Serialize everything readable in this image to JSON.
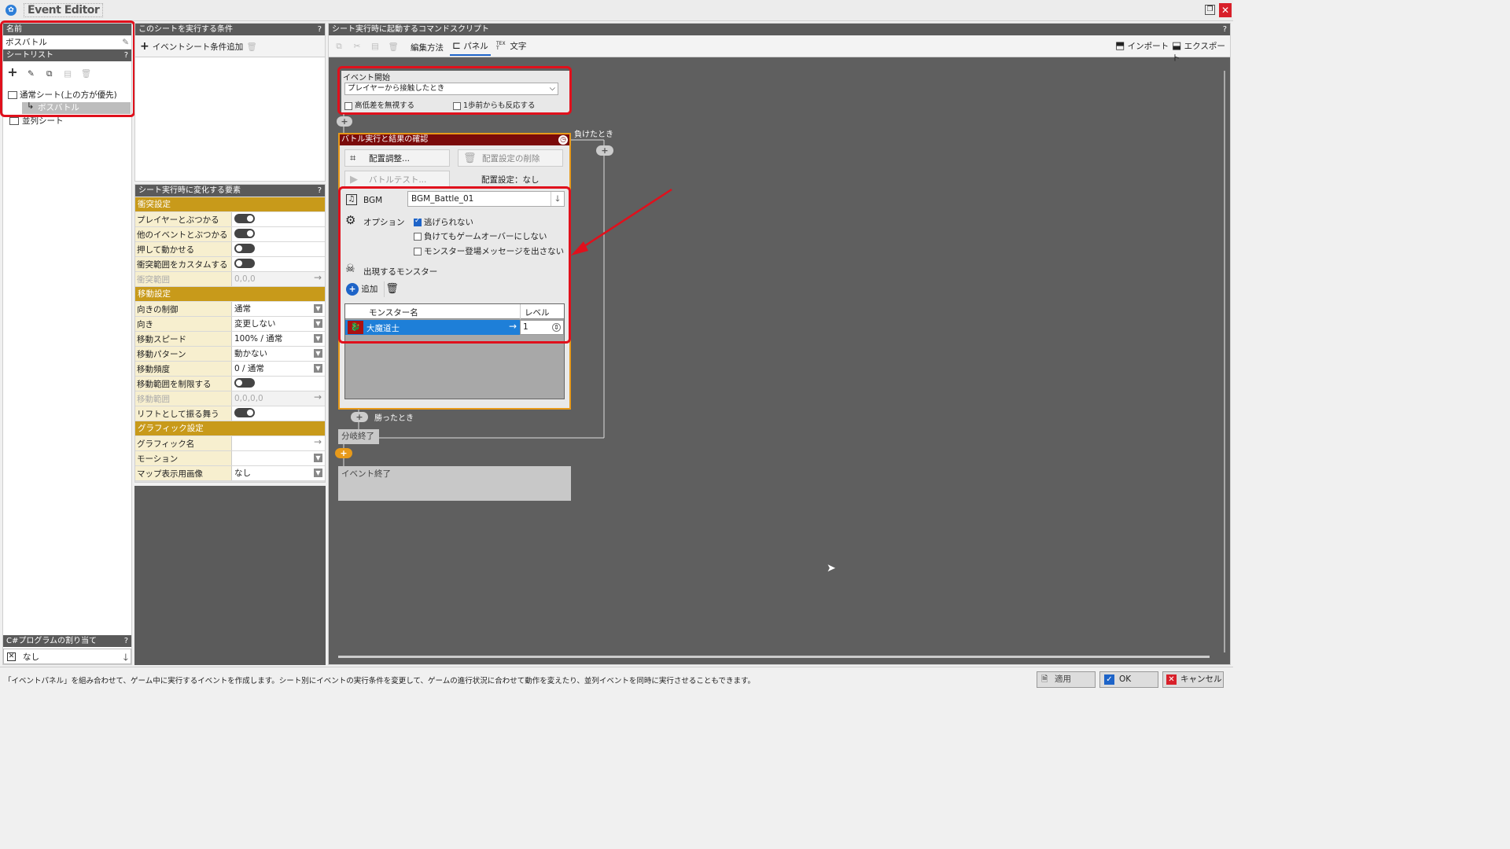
{
  "window": {
    "title": "Event Editor"
  },
  "left": {
    "name_header": "名前",
    "name_value": "ボスバトル",
    "sheetlist_header": "シートリスト",
    "tree": {
      "normal": "通常シート(上の方が優先)",
      "boss": "ボスバトル",
      "parallel": "並列シート"
    },
    "csharp_header": "C#プログラムの割り当て",
    "csharp_value": "なし"
  },
  "conditions": {
    "header": "このシートを実行する条件",
    "add_label": "イベントシート条件追加"
  },
  "props": {
    "header": "シート実行時に変化する要素",
    "sections": {
      "collision": "衝突設定",
      "movement": "移動設定",
      "graphic": "グラフィック設定"
    },
    "rows": {
      "player_hit": "プレイヤーとぶつかる",
      "event_hit": "他のイベントとぶつかる",
      "pushable": "押して動かせる",
      "custom_range": "衝突範囲をカスタムする",
      "range": "衝突範囲",
      "range_value": "0,0,0",
      "dir_control": "向きの制御",
      "dir_control_value": "通常",
      "dir": "向き",
      "dir_value": "変更しない",
      "speed": "移動スピード",
      "speed_value": "100% / 通常",
      "pattern": "移動パターン",
      "pattern_value": "動かない",
      "freq": "移動頻度",
      "freq_value": "0 / 通常",
      "limit": "移動範囲を制限する",
      "move_range": "移動範囲",
      "move_range_value": "0,0,0,0",
      "lift": "リフトとして振る舞う",
      "gfx_name": "グラフィック名",
      "motion": "モーション",
      "map_image": "マップ表示用画像",
      "map_image_value": "なし"
    }
  },
  "script": {
    "header": "シート実行時に起動するコマンドスクリプト",
    "toolbar": {
      "edit_mode": "編集方法",
      "panel": "パネル",
      "text": "文字",
      "text_icon": "TEXT",
      "import": "インポート",
      "export": "エクスポート"
    },
    "event_start": {
      "title": "イベント開始",
      "trigger": "プレイヤーから接触したとき",
      "ignore_height": "高低差を無視する",
      "one_step": "1歩前からも反応する"
    },
    "battle": {
      "title": "バトル実行と結果の確認",
      "layout_adjust": "配置調整...",
      "layout_delete": "配置設定の削除",
      "battle_test": "バトルテスト...",
      "layout_setting": "配置設定：なし",
      "bgm_label": "BGM",
      "bgm_value": "BGM_Battle_01",
      "option_label": "オプション",
      "opt_no_escape": "逃げられない",
      "opt_no_gameover": "負けてもゲームオーバーにしない",
      "opt_no_message": "モンスター登場メッセージを出さない",
      "monster_label": "出現するモンスター",
      "add": "追加",
      "col_name": "モンスター名",
      "col_level": "レベル",
      "monster_name": "大魔道士",
      "monster_level": "1"
    },
    "lose_label": "負けたとき",
    "win_label": "勝ったとき",
    "branch_end": "分岐終了",
    "event_end": "イベント終了"
  },
  "status": {
    "text": "「イベントパネル」を組み合わせて、ゲーム中に実行するイベントを作成します。シート別にイベントの実行条件を変更して、ゲームの進行状況に合わせて動作を変えたり、並列イベントを同時に実行させることもできます。",
    "apply": "適用",
    "ok": "OK",
    "cancel": "キャンセル"
  },
  "colors": {
    "accent": "#1e64c8",
    "highlight": "#e0101c",
    "section": "#c89a1a",
    "battle_header": "#7a0a0a"
  }
}
